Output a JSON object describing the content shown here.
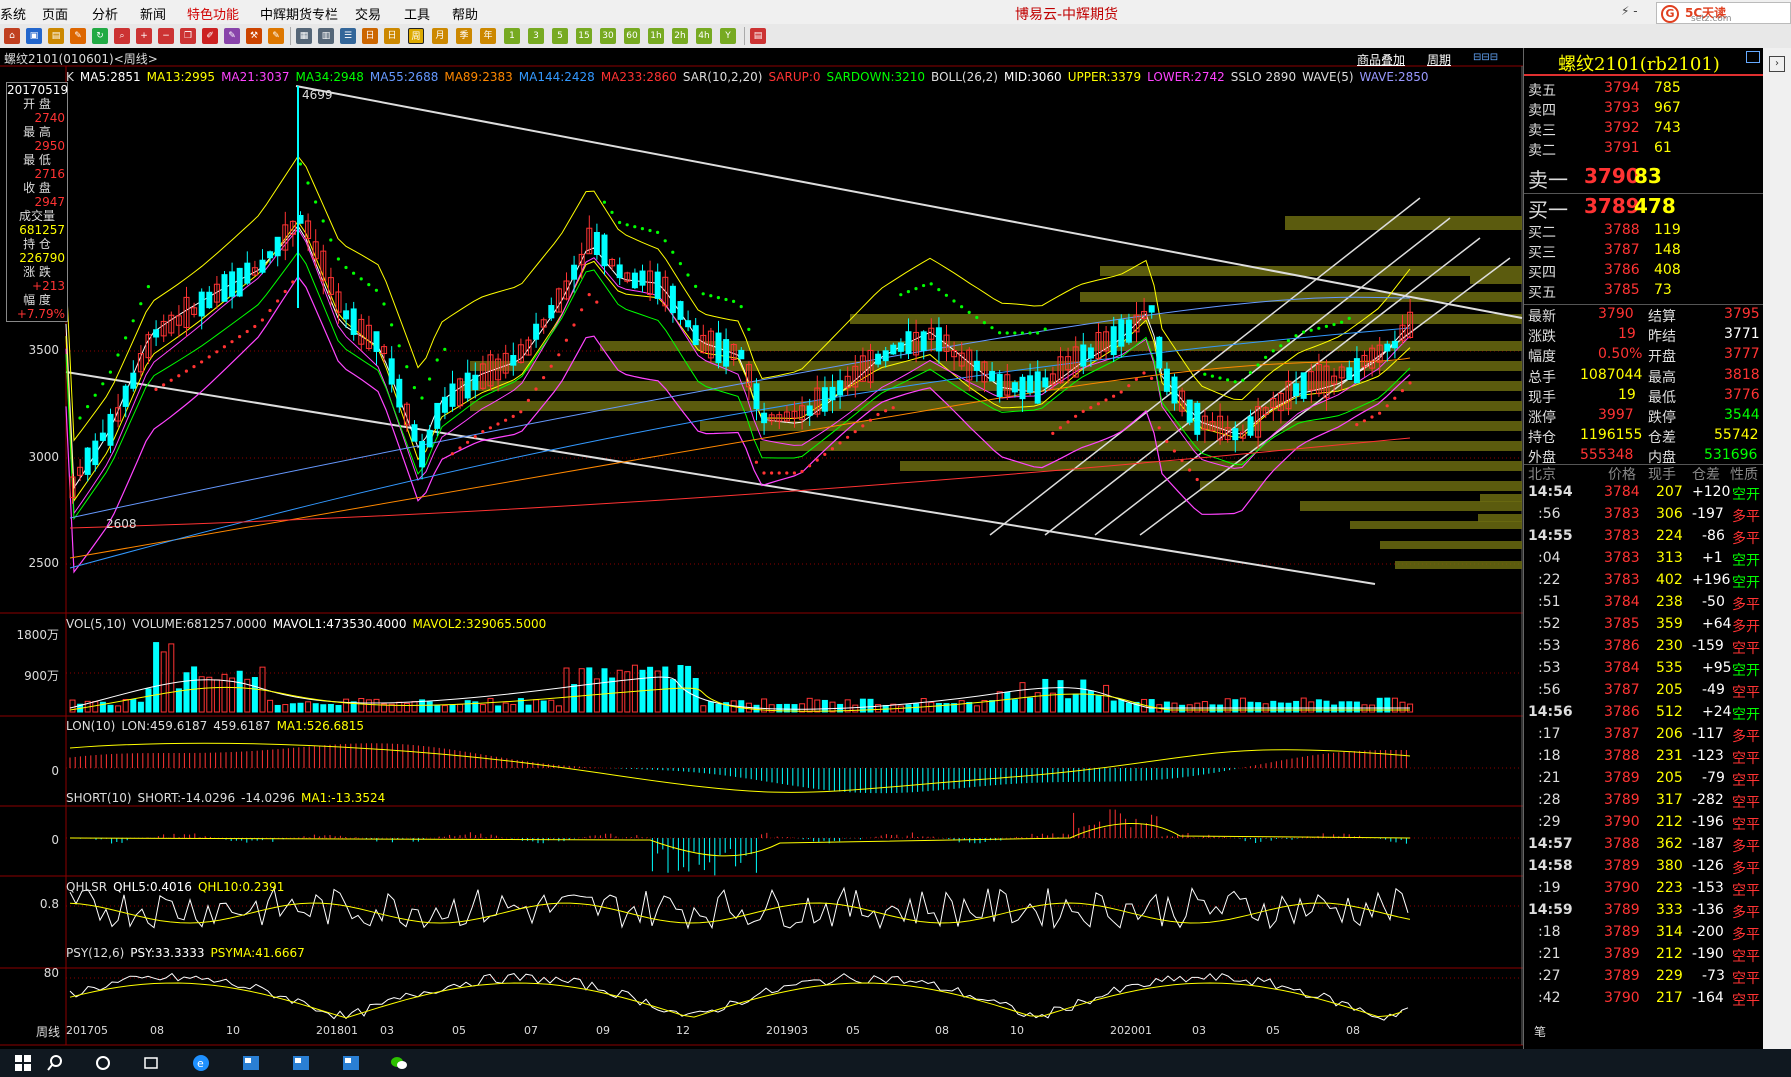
{
  "menu": {
    "items": [
      "系统",
      "页面",
      "分析",
      "新闻",
      "特色功能",
      "中辉期货专栏",
      "交易",
      "工具",
      "帮助"
    ],
    "app_title": "博易云-中辉期货",
    "brand": "5C天读",
    "brand_sub": "setz.com"
  },
  "chart": {
    "title": "螺纹2101(010601)<周线>",
    "btn_overlay": "商品叠加",
    "btn_period": "周期",
    "legend_main": [
      {
        "t": "K",
        "c": "#dddddd"
      },
      {
        "t": "MA5:2851",
        "c": "#ffffff"
      },
      {
        "t": "MA13:2995",
        "c": "#ffff00"
      },
      {
        "t": "MA21:3037",
        "c": "#ff44ff"
      },
      {
        "t": "MA34:2948",
        "c": "#00ff00"
      },
      {
        "t": "MA55:2688",
        "c": "#6699ff"
      },
      {
        "t": "MA89:2383",
        "c": "#ff8800"
      },
      {
        "t": "MA144:2428",
        "c": "#3399ff"
      },
      {
        "t": "MA233:2860",
        "c": "#ff3333"
      },
      {
        "t": "SAR(10,2,20)",
        "c": "#dddddd"
      },
      {
        "t": "SARUP:0",
        "c": "#ff3333"
      },
      {
        "t": "SARDOWN:3210",
        "c": "#00ff00"
      },
      {
        "t": "BOLL(26,2)",
        "c": "#dddddd"
      },
      {
        "t": "MID:3060",
        "c": "#ffffff"
      },
      {
        "t": "UPPER:3379",
        "c": "#ffff00"
      },
      {
        "t": "LOWER:2742",
        "c": "#ff44ff"
      },
      {
        "t": "SSLO 2890",
        "c": "#dddddd"
      },
      {
        "t": "WAVE(5)",
        "c": "#dddddd"
      },
      {
        "t": "WAVE:2850",
        "c": "#9999ff"
      }
    ],
    "y_labels": [
      "3500",
      "3000",
      "2500"
    ],
    "high_label": "4699",
    "low_label": "2608",
    "info": {
      "date": "20170519",
      "open_l": "开 盘",
      "open": "2740",
      "high_l": "最 高",
      "high": "2950",
      "low_l": "最 低",
      "low": "2716",
      "close_l": "收 盘",
      "close": "2947",
      "vol_l": "成交量",
      "vol": "681257",
      "oi_l": "持 仓",
      "oi": "226790",
      "chg_l": "涨 跌",
      "chg": "+213",
      "pct_l": "幅 度",
      "pct": "+7.79%"
    },
    "vol": {
      "legend": [
        {
          "t": "VOL(5,10)",
          "c": "#dddddd"
        },
        {
          "t": "VOLUME:681257.0000",
          "c": "#dddddd"
        },
        {
          "t": "MAVOL1:473530.4000",
          "c": "#ffffff"
        },
        {
          "t": "MAVOL2:329065.5000",
          "c": "#ffff00"
        }
      ],
      "y": [
        "1800万",
        "900万"
      ]
    },
    "lon": {
      "legend": [
        {
          "t": "LON(10)",
          "c": "#dddddd"
        },
        {
          "t": "LON:459.6187",
          "c": "#dddddd"
        },
        {
          "t": "459.6187",
          "c": "#dddddd"
        },
        {
          "t": "MA1:526.6815",
          "c": "#ffff00"
        }
      ],
      "y": "0"
    },
    "short": {
      "legend": [
        {
          "t": "SHORT(10)",
          "c": "#dddddd"
        },
        {
          "t": "SHORT:-14.0296",
          "c": "#dddddd"
        },
        {
          "t": "-14.0296",
          "c": "#dddddd"
        },
        {
          "t": "MA1:-13.3524",
          "c": "#ffff00"
        }
      ],
      "y": "0"
    },
    "qhlsr": {
      "legend": [
        {
          "t": "QHLSR",
          "c": "#dddddd"
        },
        {
          "t": "QHL5:0.4016",
          "c": "#ffffff"
        },
        {
          "t": "QHL10:0.2391",
          "c": "#ffff00"
        }
      ],
      "y": "0.8"
    },
    "psy": {
      "legend": [
        {
          "t": "PSY(12,6)",
          "c": "#dddddd"
        },
        {
          "t": "PSY:33.3333",
          "c": "#ffffff"
        },
        {
          "t": "PSYMA:41.6667",
          "c": "#ffff00"
        }
      ],
      "y": "80"
    },
    "x_label_period": "周线",
    "x_labels": [
      "201705",
      "08",
      "10",
      "201801",
      "03",
      "05",
      "07",
      "09",
      "12",
      "201903",
      "05",
      "08",
      "10",
      "202001",
      "03",
      "05",
      "08"
    ]
  },
  "quote": {
    "title": "螺纹2101(rb2101)",
    "asks": [
      {
        "l": "卖五",
        "p": "3794",
        "v": "785"
      },
      {
        "l": "卖四",
        "p": "3793",
        "v": "967"
      },
      {
        "l": "卖三",
        "p": "3792",
        "v": "743"
      },
      {
        "l": "卖二",
        "p": "3791",
        "v": "61"
      },
      {
        "l": "卖一",
        "p": "3790",
        "v": "83"
      }
    ],
    "bids": [
      {
        "l": "买一",
        "p": "3789",
        "v": "478"
      },
      {
        "l": "买二",
        "p": "3788",
        "v": "119"
      },
      {
        "l": "买三",
        "p": "3787",
        "v": "148"
      },
      {
        "l": "买四",
        "p": "3786",
        "v": "408"
      },
      {
        "l": "买五",
        "p": "3785",
        "v": "73"
      }
    ],
    "stats": [
      {
        "l1": "最新",
        "v1": "3790",
        "l2": "结算",
        "v2": "3795",
        "c1": "#ff3333",
        "c2": "#ff3333"
      },
      {
        "l1": "涨跌",
        "v1": "19",
        "l2": "昨结",
        "v2": "3771",
        "c1": "#ff3333",
        "c2": "#ffffff"
      },
      {
        "l1": "幅度",
        "v1": "0.50%",
        "l2": "开盘",
        "v2": "3777",
        "c1": "#ff3333",
        "c2": "#ff3333"
      },
      {
        "l1": "总手",
        "v1": "1087044",
        "l2": "最高",
        "v2": "3818",
        "c1": "#ffff00",
        "c2": "#ff3333"
      },
      {
        "l1": "现手",
        "v1": "19",
        "l2": "最低",
        "v2": "3776",
        "c1": "#ffff00",
        "c2": "#ff3333"
      },
      {
        "l1": "涨停",
        "v1": "3997",
        "l2": "跌停",
        "v2": "3544",
        "c1": "#ff3333",
        "c2": "#00ff00"
      },
      {
        "l1": "持仓",
        "v1": "1196155",
        "l2": "仓差",
        "v2": "55742",
        "c1": "#ffff00",
        "c2": "#ffff00"
      },
      {
        "l1": "外盘",
        "v1": "555348",
        "l2": "内盘",
        "v2": "531696",
        "c1": "#ff3333",
        "c2": "#00ff00"
      }
    ],
    "tick_header": [
      "北京",
      "价格",
      "现手",
      "仓差",
      "性质"
    ],
    "ticks": [
      {
        "t": "14:54",
        "p": "3784",
        "v": "207",
        "d": "+120",
        "n": "空开",
        "major": true
      },
      {
        "t": ":56",
        "p": "3783",
        "v": "306",
        "d": "-197",
        "n": "多平",
        "major": false
      },
      {
        "t": "14:55",
        "p": "3783",
        "v": "224",
        "d": "-86",
        "n": "多平",
        "major": true
      },
      {
        "t": ":04",
        "p": "3783",
        "v": "313",
        "d": "+1",
        "n": "空开",
        "major": false
      },
      {
        "t": ":22",
        "p": "3783",
        "v": "402",
        "d": "+196",
        "n": "空开",
        "major": false
      },
      {
        "t": ":51",
        "p": "3784",
        "v": "238",
        "d": "-50",
        "n": "多平",
        "major": false
      },
      {
        "t": ":52",
        "p": "3785",
        "v": "359",
        "d": "+64",
        "n": "多开",
        "major": false
      },
      {
        "t": ":53",
        "p": "3786",
        "v": "230",
        "d": "-159",
        "n": "空平",
        "major": false
      },
      {
        "t": ":53",
        "p": "3784",
        "v": "535",
        "d": "+95",
        "n": "空开",
        "major": false
      },
      {
        "t": ":56",
        "p": "3787",
        "v": "205",
        "d": "-49",
        "n": "空平",
        "major": false
      },
      {
        "t": "14:56",
        "p": "3786",
        "v": "512",
        "d": "+24",
        "n": "空开",
        "major": true
      },
      {
        "t": ":17",
        "p": "3787",
        "v": "206",
        "d": "-117",
        "n": "多平",
        "major": false
      },
      {
        "t": ":18",
        "p": "3788",
        "v": "231",
        "d": "-123",
        "n": "空平",
        "major": false
      },
      {
        "t": ":21",
        "p": "3789",
        "v": "205",
        "d": "-79",
        "n": "空平",
        "major": false
      },
      {
        "t": ":28",
        "p": "3789",
        "v": "317",
        "d": "-282",
        "n": "空平",
        "major": false
      },
      {
        "t": ":29",
        "p": "3790",
        "v": "212",
        "d": "-196",
        "n": "空平",
        "major": false
      },
      {
        "t": "14:57",
        "p": "3788",
        "v": "362",
        "d": "-187",
        "n": "多平",
        "major": true
      },
      {
        "t": "14:58",
        "p": "3789",
        "v": "380",
        "d": "-126",
        "n": "多平",
        "major": true
      },
      {
        "t": ":19",
        "p": "3790",
        "v": "223",
        "d": "-153",
        "n": "空平",
        "major": false
      },
      {
        "t": "14:59",
        "p": "3789",
        "v": "333",
        "d": "-136",
        "n": "多平",
        "major": true
      },
      {
        "t": ":18",
        "p": "3789",
        "v": "314",
        "d": "-200",
        "n": "多平",
        "major": false
      },
      {
        "t": ":21",
        "p": "3789",
        "v": "212",
        "d": "-190",
        "n": "空平",
        "major": false
      },
      {
        "t": ":27",
        "p": "3789",
        "v": "229",
        "d": "-73",
        "n": "空平",
        "major": false
      },
      {
        "t": ":42",
        "p": "3790",
        "v": "217",
        "d": "-164",
        "n": "空平",
        "major": false
      }
    ],
    "footer": "笔"
  },
  "colors": {
    "up": "#ff3333",
    "down": "#00ffff",
    "yellow": "#ffff00",
    "green": "#00ff00",
    "grid": "#8b0000"
  }
}
